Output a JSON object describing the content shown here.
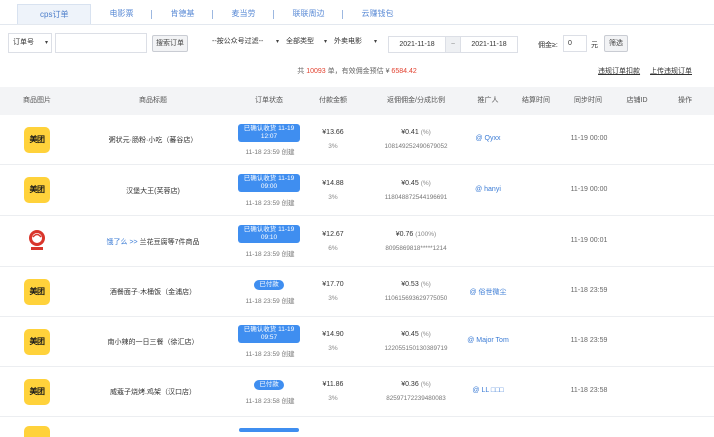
{
  "tabs": [
    {
      "label": "cps订单",
      "active": true
    },
    {
      "label": "电影票",
      "active": false
    },
    {
      "label": "肯德基",
      "active": false
    },
    {
      "label": "麦当劳",
      "active": false
    },
    {
      "label": "联联周边",
      "active": false
    },
    {
      "label": "云赚钱包",
      "active": false
    }
  ],
  "filters": {
    "order_type": "订单号",
    "search_placeholder": "",
    "search_button": "搜索订单",
    "account_filter": "--按公众号过滤--",
    "type_filter": "全部类型",
    "category_filter": "外卖电影",
    "date_from": "2021-11-18",
    "date_sep": "~",
    "date_to": "2021-11-18",
    "commission_label": "佣金≥:",
    "commission_value": "0",
    "commission_unit": "元",
    "filter_button": "筛选"
  },
  "summary": {
    "prefix": "共",
    "count": "10093",
    "middle": "单，有效佣金预估 ¥",
    "amount": "6584.42"
  },
  "links": {
    "deduct": "违规订单扣款",
    "upload": "上传违规订单"
  },
  "columns": [
    "商品图片",
    "商品标题",
    "订单状态",
    "付款金额",
    "返佣佣金/分成比例",
    "推广人",
    "结算时间",
    "同步时间",
    "店铺ID",
    "操作"
  ],
  "rows": [
    {
      "logo": "美团",
      "logo_type": "meituan",
      "title_prefix": "",
      "title": "粥状元·肠粉·小吃（蕃谷店）",
      "status": "已确认收货 11-19 12:07",
      "status_style": "box",
      "created": "11-18 23:59 创建",
      "amount": "¥13.66",
      "pct": "3%",
      "commission": "¥0.41",
      "commission_note": "(%)",
      "order_id": "108149252490679052",
      "promoter": "@ Qyxx",
      "sync_time": "11-19 00:00"
    },
    {
      "logo": "美团",
      "logo_type": "meituan",
      "title_prefix": "",
      "title": "汉堡大王(芙蓉店)",
      "status": "已确认收货 11-19 09:00",
      "status_style": "box",
      "created": "11-18 23:59 创建",
      "amount": "¥14.88",
      "pct": "3%",
      "commission": "¥0.45",
      "commission_note": "(%)",
      "order_id": "118048872544196691",
      "promoter": "@ hanyi",
      "sync_time": "11-19 00:00"
    },
    {
      "logo": "饿了么",
      "logo_type": "eleme",
      "title_prefix": "饿了么 >>",
      "title": "兰花豆腐等7件商品",
      "status": "已确认收货 11-19 09:10",
      "status_style": "box",
      "created": "11-18 23:59 创建",
      "amount": "¥12.67",
      "pct": "6%",
      "commission": "¥0.76",
      "commission_note": "(100%)",
      "order_id": "8095869818*****1214",
      "promoter": "",
      "sync_time": "11-19 00:01"
    },
    {
      "logo": "美团",
      "logo_type": "meituan",
      "title_prefix": "",
      "title": "酒餐面子·木桶饭（金浦店）",
      "status": "已付款",
      "status_style": "pill",
      "created": "11-18 23:59 创建",
      "amount": "¥17.70",
      "pct": "3%",
      "commission": "¥0.53",
      "commission_note": "(%)",
      "order_id": "110615693629775050",
      "promoter": "@ 俗世微尘",
      "sync_time": "11-18 23:59"
    },
    {
      "logo": "美团",
      "logo_type": "meituan",
      "title_prefix": "",
      "title": "南小辣的一日三餐（徐汇店）",
      "status": "已确认收货 11-19 09:57",
      "status_style": "box",
      "created": "11-18 23:59 创建",
      "amount": "¥14.90",
      "pct": "3%",
      "commission": "¥0.45",
      "commission_note": "(%)",
      "order_id": "122055150130389719",
      "promoter": "@ Major Tom",
      "sync_time": "11-18 23:59"
    },
    {
      "logo": "美团",
      "logo_type": "meituan",
      "title_prefix": "",
      "title": "威蔻子烧烤.鸡架（汉口店）",
      "status": "已付款",
      "status_style": "pill",
      "created": "11-18 23:58 创建",
      "amount": "¥11.86",
      "pct": "3%",
      "commission": "¥0.36",
      "commission_note": "(%)",
      "order_id": "82597172239480083",
      "promoter": "@ LL □□□",
      "sync_time": "11-18 23:58"
    }
  ],
  "colors": {
    "accent": "#3f8ef0",
    "highlight": "#e2412f",
    "logo_yellow": "#ffd23b"
  }
}
